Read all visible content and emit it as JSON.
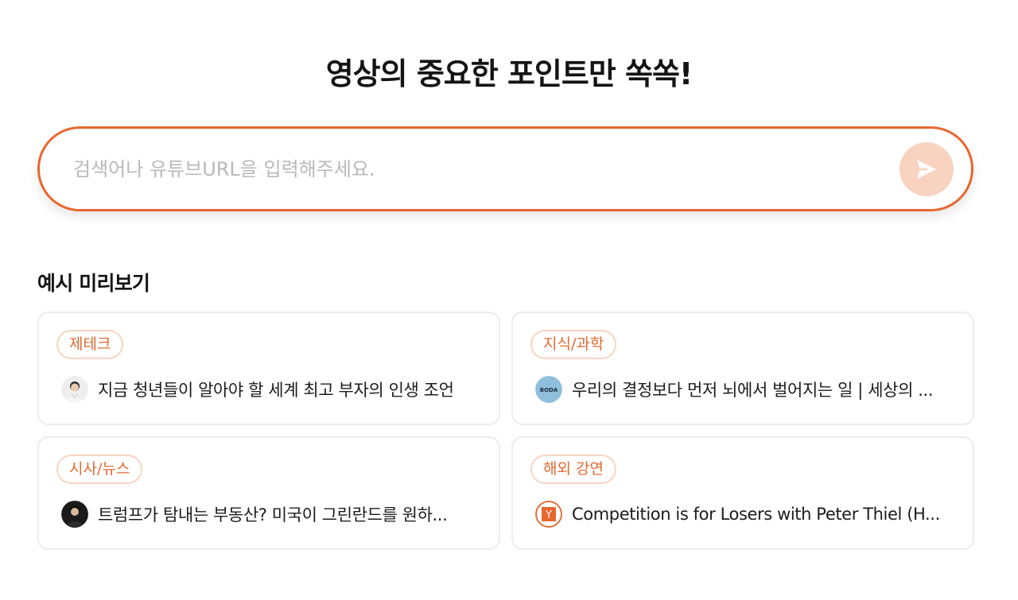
{
  "hero": {
    "title": "영상의 중요한 포인트만 쏙쏙!"
  },
  "search": {
    "placeholder": "검색어나 유튜브URL을 입력해주세요."
  },
  "examples": {
    "title": "예시 미리보기",
    "cards": [
      {
        "tag": "제테크",
        "video_title": "지금 청년들이 알아야 할 세계 최고 부자의 인생 조언",
        "avatar_icon": "person-avatar-icon"
      },
      {
        "tag": "지식/과학",
        "video_title": "우리의 결정보다 먼저 뇌에서 벌어지는 일 | 세상의 ...",
        "avatar_icon": "boda-logo-icon",
        "avatar_text": "BODA"
      },
      {
        "tag": "시사/뉴스",
        "video_title": "트럼프가 탐내는 부동산? 미국이 그린란드를 원하...",
        "avatar_icon": "person-avatar-icon"
      },
      {
        "tag": "해외 강연",
        "video_title": "Competition is for Losers with Peter Thiel (H...",
        "avatar_icon": "y-combinator-logo-icon",
        "avatar_text": "Y"
      }
    ]
  },
  "colors": {
    "accent": "#e8672f",
    "tag_text": "#e06a32",
    "tag_border": "#f7d5c3",
    "send_button_bg": "#f8d3c0"
  }
}
